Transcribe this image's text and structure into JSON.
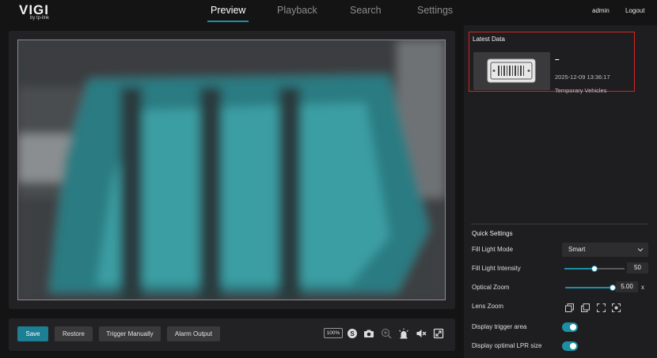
{
  "brand": {
    "name": "VIGI",
    "sub": "by tp-link"
  },
  "nav": {
    "tabs": [
      "Preview",
      "Playback",
      "Search",
      "Settings"
    ],
    "active": "Preview"
  },
  "user": {
    "name": "admin",
    "logout": "Logout"
  },
  "toolbar": {
    "save_label": "Save",
    "restore_label": "Restore",
    "trigger_label": "Trigger Manually",
    "alarm_label": "Alarm Output",
    "zoom_level": "100%"
  },
  "latest": {
    "title": "Latest Data",
    "plate": "–",
    "time": "2025-12-09 13:36:17",
    "type": "Temporary Vehicles"
  },
  "quick_settings": {
    "title": "Quick Settings",
    "fill_light_mode": {
      "label": "Fill Light Mode",
      "value": "Smart"
    },
    "fill_light_intensity": {
      "label": "Fill Light Intensity",
      "value": "50",
      "level": 50
    },
    "optical_zoom": {
      "label": "Optical Zoom",
      "value": "5.00",
      "unit": "x",
      "level": 100
    },
    "lens_zoom": {
      "label": "Lens Zoom"
    },
    "display_trigger_area": {
      "label": "Display trigger area",
      "on": true
    },
    "display_optimal_lpr": {
      "label": "Display optimal LPR size",
      "on": true
    }
  },
  "colors": {
    "accent": "#1d8fa3",
    "highlight_border": "#d32525",
    "primary_button": "#1c7f94"
  },
  "icons": [
    "snapshot-s-icon",
    "camera-icon",
    "zoom-in-icon",
    "alarm-light-icon",
    "mute-icon",
    "fullscreen-icon",
    "chevron-down-icon",
    "barcode-plate-icon"
  ]
}
